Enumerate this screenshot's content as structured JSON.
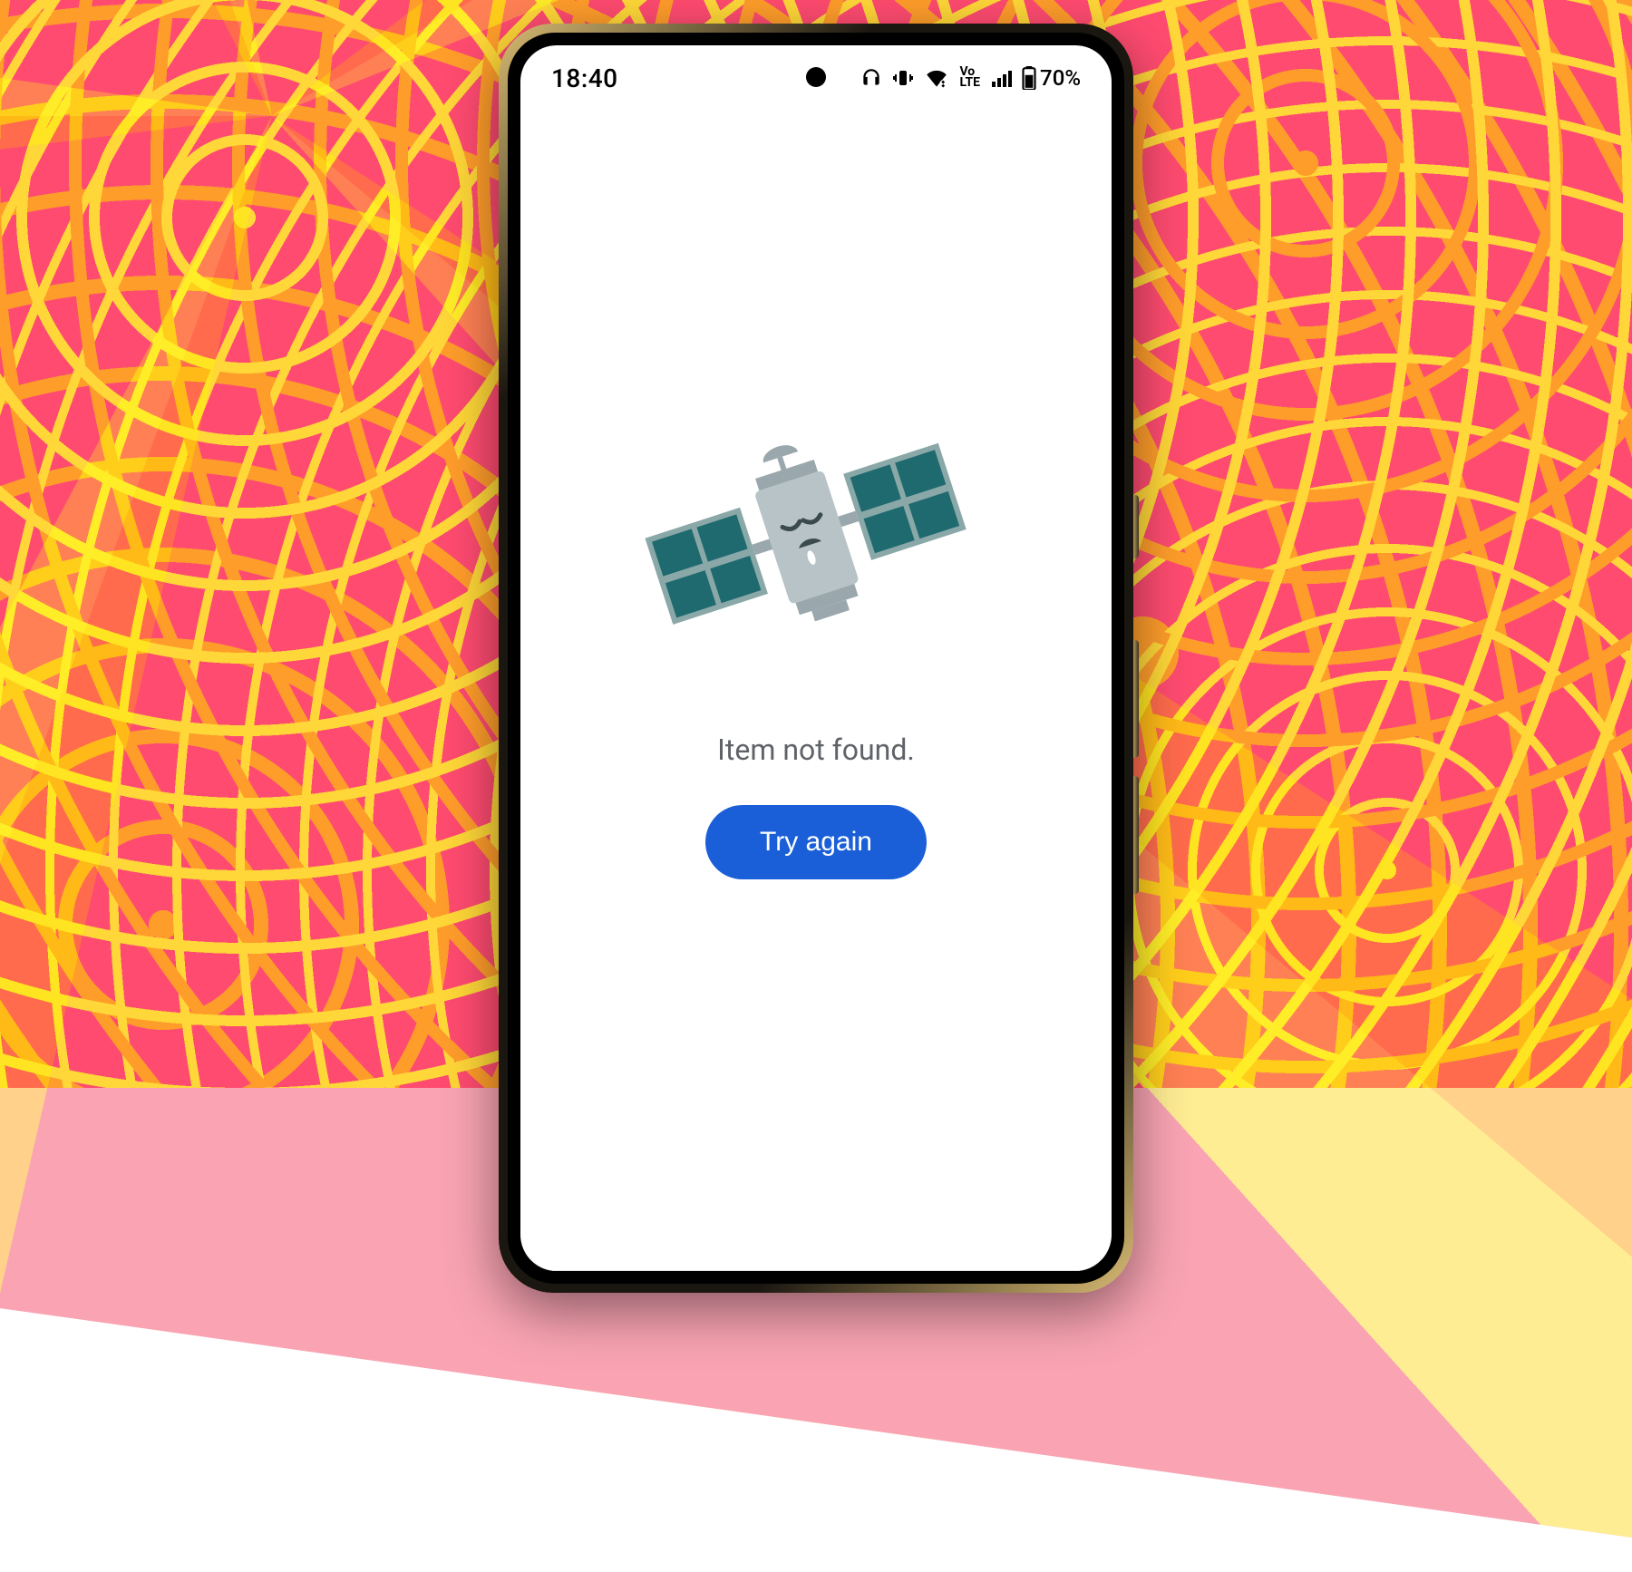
{
  "statusbar": {
    "time": "18:40",
    "volte": "Vo\nLTE",
    "battery_pct": "70%"
  },
  "error": {
    "message": "Item not found.",
    "retry_label": "Try again"
  },
  "icons": {
    "headphones": "headphones-icon",
    "vibrate": "vibrate-icon",
    "wifi": "wifi-icon",
    "signal": "cellular-signal-icon",
    "battery": "battery-icon",
    "satellite": "sad-satellite-icon"
  },
  "colors": {
    "button_bg": "#1a5fd8",
    "text_muted": "#5f6368",
    "sat_body": "#b7c3c7",
    "sat_body_dark": "#9aa8ad",
    "sat_panel": "#1e6a6f",
    "sat_panel_bg": "#8aa8a8"
  }
}
